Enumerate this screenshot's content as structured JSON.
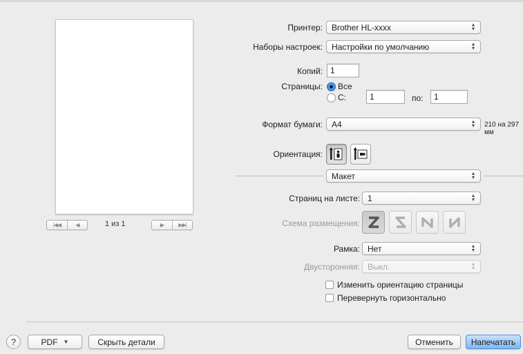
{
  "preview": {
    "page_indicator": "1 из 1",
    "nav_first": "|◀◀",
    "nav_prev": "◀",
    "nav_next": "▶",
    "nav_last": "▶▶|"
  },
  "printer": {
    "label": "Принтер:",
    "value": "Brother HL-xxxx"
  },
  "presets": {
    "label": "Наборы настроек:",
    "value": "Настройки по умолчанию"
  },
  "copies": {
    "label": "Копий:",
    "value": "1"
  },
  "pages": {
    "label": "Страницы:",
    "all_label": "Все",
    "from_label": "С:",
    "from_value": "1",
    "to_label": "по:",
    "to_value": "1",
    "selected": "all"
  },
  "paper_size": {
    "label": "Формат бумаги:",
    "value": "A4",
    "dimensions": "210 на 297 мм"
  },
  "orientation": {
    "label": "Ориентация:",
    "selected": "portrait"
  },
  "section_popup": {
    "value": "Макет"
  },
  "pages_per_sheet": {
    "label": "Страниц на листе:",
    "value": "1"
  },
  "layout_direction": {
    "label": "Схема размещения:",
    "options": [
      "Z",
      "S",
      "N-reverse",
      "N"
    ],
    "selected": 0
  },
  "border": {
    "label": "Рамка:",
    "value": "Нет"
  },
  "two_sided": {
    "label": "Двусторонняя:",
    "value": "Выкл."
  },
  "checkboxes": {
    "reverse_orientation": "Изменить ориентацию страницы",
    "flip_horizontal": "Перевернуть горизонтально"
  },
  "footer": {
    "help": "?",
    "pdf": "PDF",
    "hide_details": "Скрыть детали",
    "cancel": "Отменить",
    "print": "Напечатать"
  },
  "colors": {
    "accent": "#7db7f1",
    "background": "#ececec"
  }
}
